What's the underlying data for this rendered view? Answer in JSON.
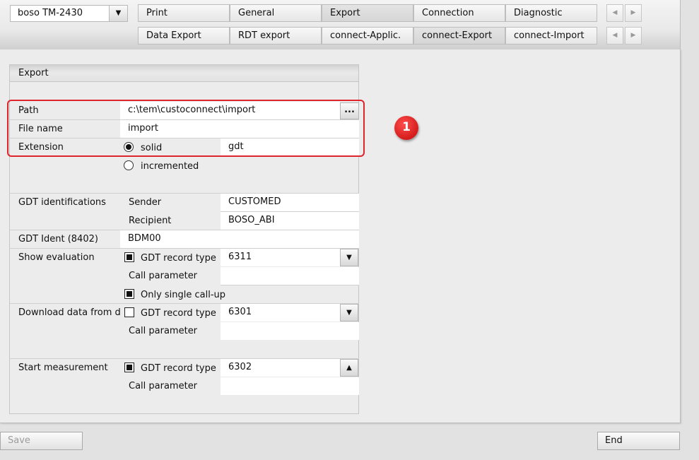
{
  "device": {
    "selected": "boso TM-2430",
    "arrow": "▼"
  },
  "tabs_row1": [
    "Print",
    "General",
    "Export",
    "Connection",
    "Diagnostic"
  ],
  "tabs_row2": [
    "Data Export",
    "RDT export",
    "connect-Applic.",
    "connect-Export",
    "connect-Import"
  ],
  "active_tabs": {
    "row1": "Export",
    "row2": "connect-Export"
  },
  "nav": {
    "left": "◀",
    "right": "▶"
  },
  "export": {
    "title": "Export",
    "path_label": "Path",
    "path_value": "c:\\tem\\custoconnect\\import",
    "browse_label": "...",
    "filename_label": "File name",
    "filename_value": "import",
    "extension_label": "Extension",
    "ext_solid_label": "solid",
    "ext_solid_value": "gdt",
    "ext_incremented_label": "incremented",
    "ext_selected": "solid"
  },
  "gdt_ident": {
    "label": "GDT identifications",
    "sender_label": "Sender",
    "sender_value": "CUSTOMED",
    "recipient_label": "Recipient",
    "recipient_value": "BOSO_ABI"
  },
  "gdt_8402": {
    "label": "GDT Ident (8402)",
    "value": "BDM00"
  },
  "show_evaluation": {
    "label": "Show evaluation",
    "record_type_label": "GDT record type",
    "record_type_checked": true,
    "record_type_value": "6311",
    "call_param_label": "Call parameter",
    "call_param_value": "",
    "single_callup_label": "Only single call-up",
    "single_callup_checked": true
  },
  "download_data": {
    "label": "Download data from device",
    "record_type_label": "GDT record type",
    "record_type_checked": false,
    "record_type_value": "6301",
    "call_param_label": "Call parameter",
    "call_param_value": ""
  },
  "start_measurement": {
    "label": "Start measurement",
    "record_type_label": "GDT record type",
    "record_type_checked": true,
    "record_type_value": "6302",
    "call_param_label": "Call parameter",
    "call_param_value": ""
  },
  "dropdown_arrows": {
    "down": "▼",
    "up": "▲"
  },
  "annotation": {
    "marker_number": "1",
    "highlight_color": "#e0242b"
  },
  "buttons": {
    "save": "Save",
    "end": "End"
  }
}
